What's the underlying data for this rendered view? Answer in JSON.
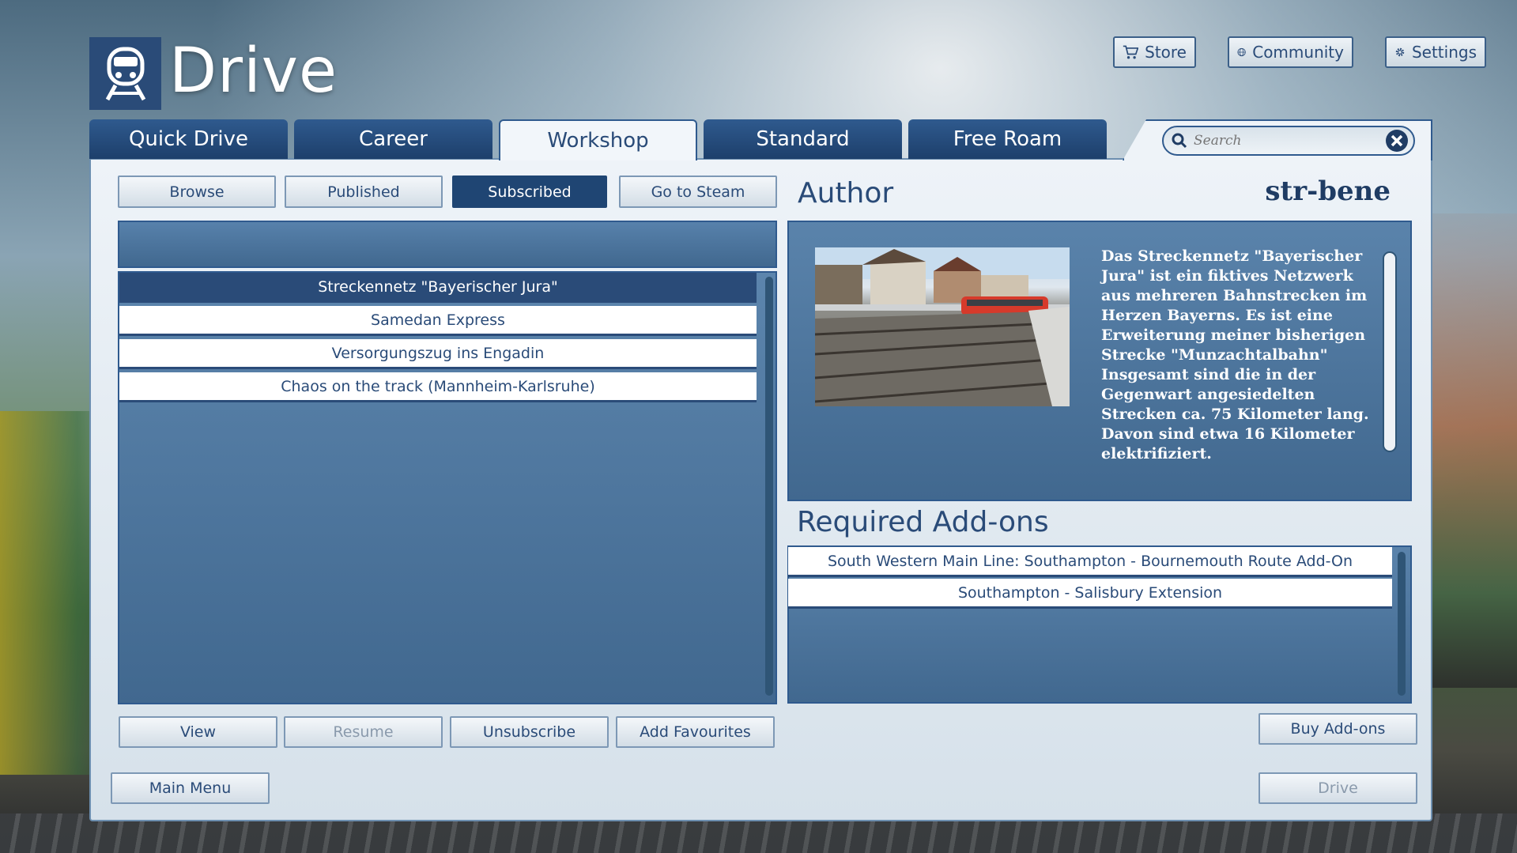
{
  "app": {
    "title": "Drive",
    "logo_icon": "train-icon",
    "brand_color": "#2a4b78"
  },
  "top_nav": [
    {
      "label": "Store",
      "icon": "cart-icon"
    },
    {
      "label": "Community",
      "icon": "globe-icon"
    },
    {
      "label": "Settings",
      "icon": "gear-icon"
    }
  ],
  "tabs": [
    {
      "label": "Quick Drive",
      "active": false
    },
    {
      "label": "Career",
      "active": false
    },
    {
      "label": "Workshop",
      "active": true
    },
    {
      "label": "Standard",
      "active": false
    },
    {
      "label": "Free Roam",
      "active": false
    }
  ],
  "search": {
    "placeholder": "Search",
    "value": ""
  },
  "subtabs": [
    {
      "label": "Browse",
      "active": false
    },
    {
      "label": "Published",
      "active": false
    },
    {
      "label": "Subscribed",
      "active": true
    },
    {
      "label": "Go to Steam",
      "active": false
    }
  ],
  "items": [
    {
      "label": "Streckennetz \"Bayerischer Jura\"",
      "selected": true
    },
    {
      "label": "Samedan Express",
      "selected": false
    },
    {
      "label": "Versorgungszug ins Engadin",
      "selected": false
    },
    {
      "label": "Chaos on the track (Mannheim-Karlsruhe)",
      "selected": false
    }
  ],
  "detail": {
    "author_label": "Author",
    "author_name": "str-bene",
    "description": "Das Streckennetz \"Bayerischer Jura\" ist ein fiktives Netzwerk aus mehreren Bahnstrecken im Herzen Bayerns. Es ist eine Erweiterung meiner bisherigen Strecke \"Munzachtalbahn\" Insgesamt sind die in der Gegenwart angesiedelten Strecken ca. 75 Kilometer lang. Davon sind etwa 16 Kilometer elektrifiziert.",
    "required_title": "Required Add-ons",
    "required": [
      "South Western Main Line: Southampton - Bournemouth Route Add-On",
      "Southampton - Salisbury Extension"
    ]
  },
  "actions": {
    "view": "View",
    "resume": "Resume",
    "unsubscribe": "Unsubscribe",
    "add_favourites": "Add Favourites",
    "buy_addons": "Buy Add-ons",
    "main_menu": "Main Menu",
    "drive": "Drive"
  }
}
